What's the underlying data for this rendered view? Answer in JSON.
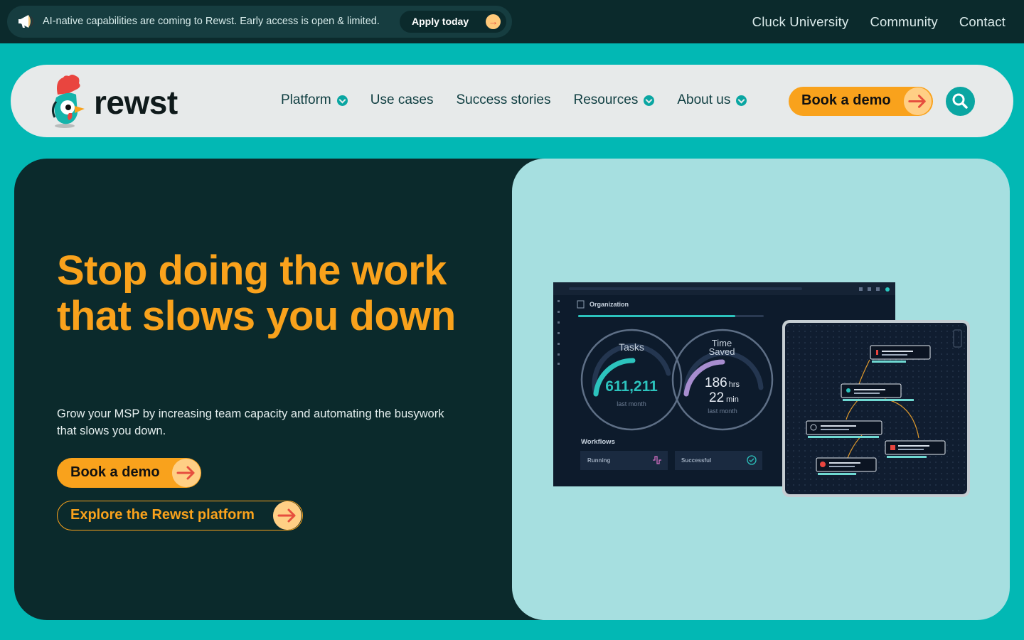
{
  "announcement": {
    "message": "AI-native capabilities are coming to Rewst. Early access is open & limited.",
    "cta": "Apply today"
  },
  "top_links": [
    "Cluck University",
    "Community",
    "Contact"
  ],
  "nav": {
    "logo_text": "rewst",
    "items": [
      {
        "label": "Platform",
        "dropdown": true
      },
      {
        "label": "Use cases",
        "dropdown": false
      },
      {
        "label": "Success stories",
        "dropdown": false
      },
      {
        "label": "Resources",
        "dropdown": true
      },
      {
        "label": "About us",
        "dropdown": true
      }
    ],
    "cta": "Book a demo",
    "search_icon": "search-icon"
  },
  "hero": {
    "headline": "Stop doing the work that slows you down",
    "subtext": "Grow your MSP by increasing team capacity and automating the busywork that slows you down.",
    "primary_cta": "Book a demo",
    "secondary_cta": "Explore the Rewst platform"
  },
  "dashboard": {
    "org_label": "Organization",
    "tasks_title": "Tasks",
    "tasks_value": "611,211",
    "tasks_caption": "last month",
    "saved_title_1": "Time",
    "saved_title_2": "Saved",
    "saved_hours": "186",
    "saved_hours_unit": "hrs",
    "saved_minutes": "22",
    "saved_minutes_unit": "min",
    "saved_caption": "last month",
    "workflows_label": "Workflows",
    "running_label": "Running",
    "successful_label": "Successful"
  },
  "colors": {
    "teal_bg": "#02b8b4",
    "dark": "#0b2a2c",
    "orange": "#f9a21c",
    "light_teal": "#a6dfe0"
  }
}
